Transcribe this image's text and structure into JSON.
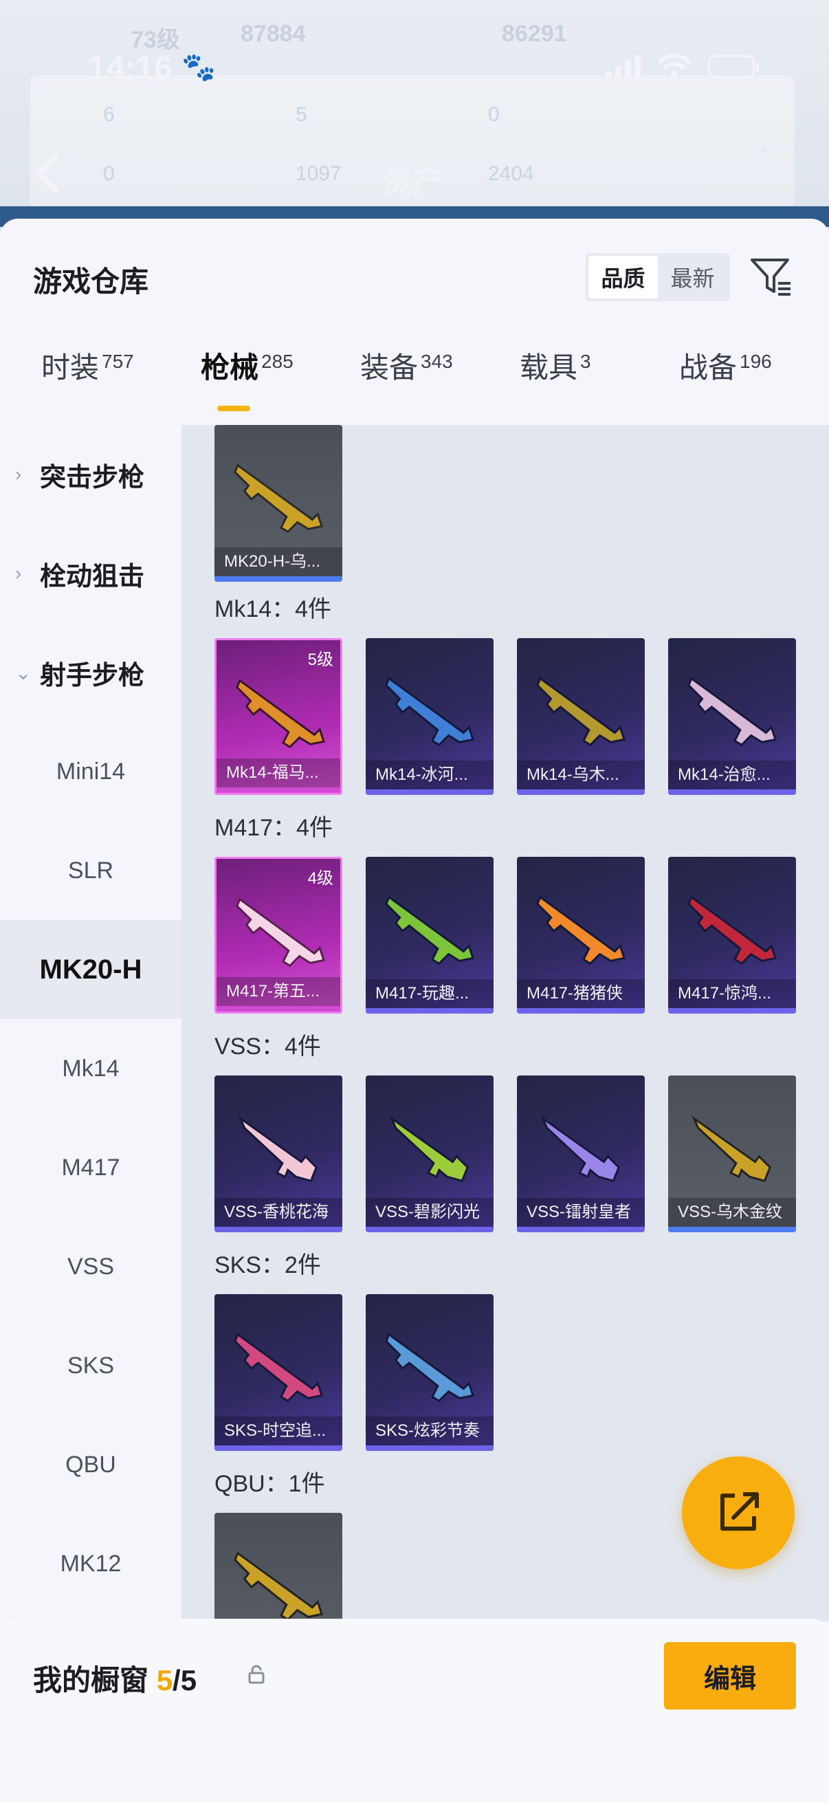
{
  "status_bar": {
    "time": "14:16"
  },
  "background_header": {
    "title": "资产",
    "faded_values": [
      "73级",
      "87884",
      "86291",
      "6",
      "5",
      "0",
      "0",
      "1097",
      "2404"
    ]
  },
  "sheet": {
    "title": "游戏仓库",
    "sort": {
      "options": [
        "品质",
        "最新"
      ],
      "active": "品质"
    }
  },
  "tabs": [
    {
      "label": "时装",
      "count": "757",
      "active": false
    },
    {
      "label": "枪械",
      "count": "285",
      "active": true
    },
    {
      "label": "装备",
      "count": "343",
      "active": false
    },
    {
      "label": "载具",
      "count": "3",
      "active": false
    },
    {
      "label": "战备",
      "count": "196",
      "active": false
    }
  ],
  "sidebar": {
    "categories": [
      {
        "label": "突击步枪",
        "expanded": false
      },
      {
        "label": "栓动狙击",
        "expanded": false
      },
      {
        "label": "射手步枪",
        "expanded": true
      }
    ],
    "subitems": [
      "Mini14",
      "SLR",
      "MK20-H",
      "Mk14",
      "M417",
      "VSS",
      "SKS",
      "QBU",
      "MK12"
    ],
    "selected": "MK20-H"
  },
  "groups": {
    "mk20": {
      "items": [
        {
          "name": "MK20-H-乌...",
          "rarity": "gray"
        }
      ]
    },
    "mk14": {
      "label": "Mk14：4件",
      "items": [
        {
          "name": "Mk14-福马...",
          "rarity": "pink",
          "level": "5级"
        },
        {
          "name": "Mk14-冰河...",
          "rarity": "purple"
        },
        {
          "name": "Mk14-乌木...",
          "rarity": "purple"
        },
        {
          "name": "Mk14-治愈...",
          "rarity": "purple"
        }
      ]
    },
    "m417": {
      "label": "M417：4件",
      "items": [
        {
          "name": "M417-第五...",
          "rarity": "pink",
          "level": "4级"
        },
        {
          "name": "M417-玩趣...",
          "rarity": "purple"
        },
        {
          "name": "M417-猪猪侠",
          "rarity": "purple"
        },
        {
          "name": "M417-惊鸿...",
          "rarity": "purple"
        }
      ]
    },
    "vss": {
      "label": "VSS：4件",
      "items": [
        {
          "name": "VSS-香桃花海",
          "rarity": "purple"
        },
        {
          "name": "VSS-碧影闪光",
          "rarity": "purple"
        },
        {
          "name": "VSS-镭射皇者",
          "rarity": "purple"
        },
        {
          "name": "VSS-乌木金纹",
          "rarity": "gray"
        }
      ]
    },
    "sks": {
      "label": "SKS：2件",
      "items": [
        {
          "name": "SKS-时空追...",
          "rarity": "purple"
        },
        {
          "name": "SKS-炫彩节奏",
          "rarity": "purple"
        }
      ]
    },
    "qbu": {
      "label": "QBU：1件",
      "items": [
        {
          "name": "",
          "rarity": "gray"
        }
      ]
    }
  },
  "fab": {
    "icon": "share-export-icon"
  },
  "showcase": {
    "title": "我的橱窗",
    "current": "5",
    "sep": "/",
    "total": "5",
    "edit_label": "编辑"
  },
  "colors": {
    "accent": "#f8ac10",
    "rare_purple": "#6d63e8",
    "legendary_pink": "#d24ad4",
    "active_tab_bar": "#f5b40a"
  }
}
